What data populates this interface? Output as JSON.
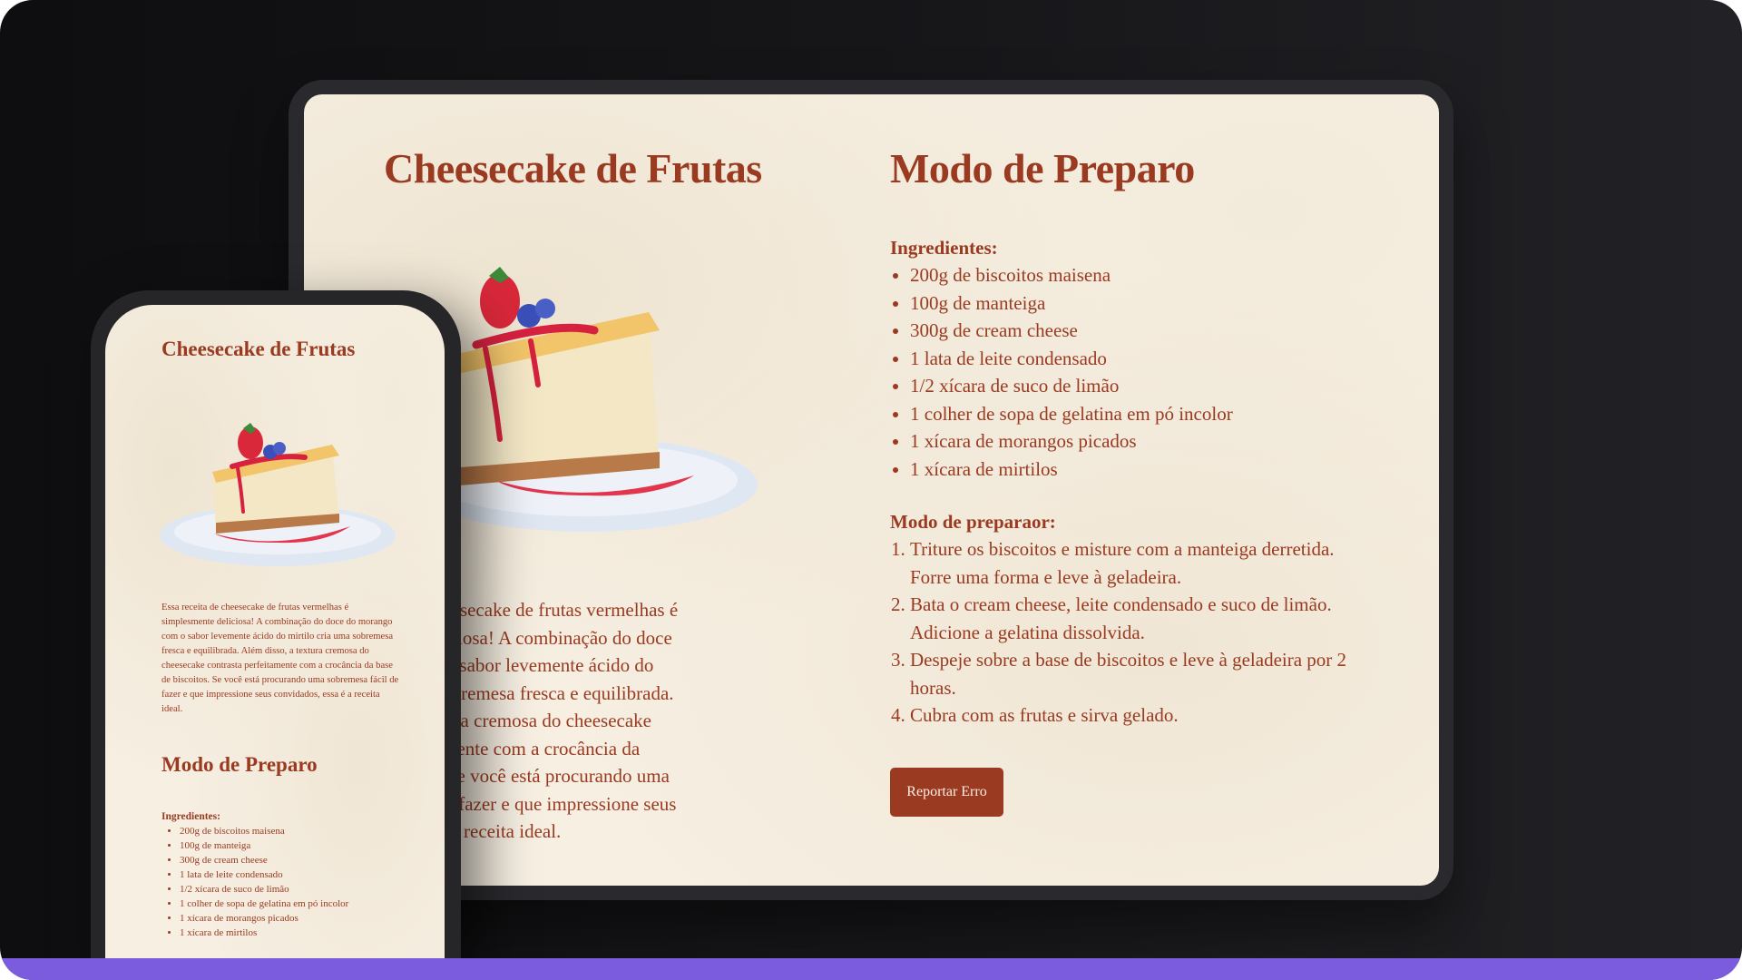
{
  "recipe": {
    "title": "Cheesecake de Frutas",
    "description": "Essa receita de cheesecake de frutas vermelhas é simplesmente deliciosa! A combinação do doce do morango com o sabor levemente ácido do mirtilo cria uma sobremesa fresca e equilibrada. Além disso, a textura cremosa do cheesecake contrasta perfeitamente com a crocância da base de biscoitos. Se você está procurando uma sobremesa fácil de fazer e que impressione seus convidados, essa é a receita ideal.",
    "tablet_description_visible": "ta de cheesecake de frutas vermelhas é\nente deliciosa! A combinação do doce\ngo com o sabor levemente ácido do\na uma sobremesa fresca e equilibrada.\no, a textura cremosa do cheesecake\nperfeitamente com a crocância da\nscoitos. Se você está procurando uma\na fácil de fazer e que impressione seus\ns, essa é a receita ideal.",
    "preparo_title": "Modo de Preparo",
    "ingredients_heading": "Ingredientes:",
    "ingredients": [
      "200g de biscoitos maisena",
      "100g de manteiga",
      "300g de cream cheese",
      "1 lata de leite condensado",
      "1/2 xícara de suco de limão",
      "1 colher de sopa de gelatina em pó incolor",
      "1 xícara de morangos picados",
      "1 xícara de mirtilos"
    ],
    "steps_heading": "Modo de preparaor:",
    "steps": [
      "Triture os biscoitos e misture com a manteiga derretida. Forre uma forma e leve à geladeira.",
      "Bata o cream cheese, leite condensado e suco de limão. Adicione a gelatina dissolvida.",
      "Despeje sobre a base de biscoitos e leve à geladeira por 2 horas.",
      "Cubra com as frutas e sirva gelado."
    ],
    "report_button": "Reportar Erro"
  },
  "colors": {
    "accent": "#9a3a21",
    "paper": "#f6efe2",
    "frame": "#2a2a2e",
    "bottom_bar": "#7c5cde"
  },
  "icons": {
    "cake": "cheesecake-illustration"
  }
}
